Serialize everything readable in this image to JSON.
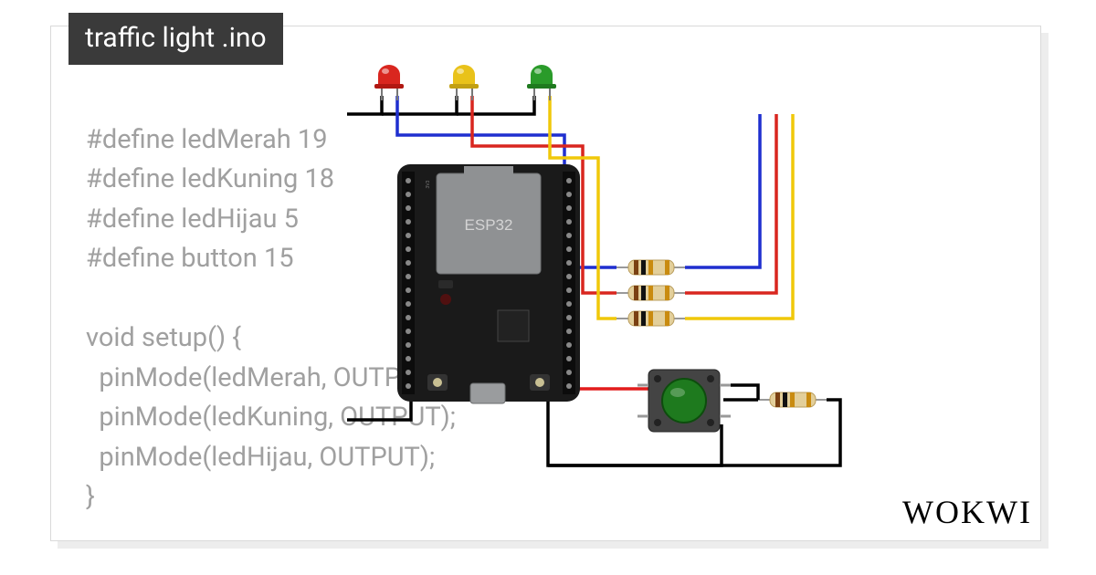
{
  "title": "traffic light .ino",
  "code_lines": [
    "#define ledMerah 19",
    "#define ledKuning 18",
    "#define ledHijau 5",
    "#define button 15",
    "",
    "void setup() {",
    "  pinMode(ledMerah, OUTPUT);",
    "  pinMode(ledKuning, OUTPUT);",
    "  pinMode(ledHijau, OUTPUT);",
    "}"
  ],
  "brand": "WOKWI",
  "circuit": {
    "mcu_label": "ESP32",
    "leds": [
      {
        "name": "red",
        "color": "#d9261f"
      },
      {
        "name": "yellow",
        "color": "#e9c21a"
      },
      {
        "name": "green",
        "color": "#2a9b2a"
      }
    ],
    "resistors": 4,
    "button": true,
    "wires": {
      "blue": "#1f2fcf",
      "red": "#d9261f",
      "yellow": "#f0c80a",
      "black": "#000",
      "redpower": "#e21c1c"
    }
  }
}
